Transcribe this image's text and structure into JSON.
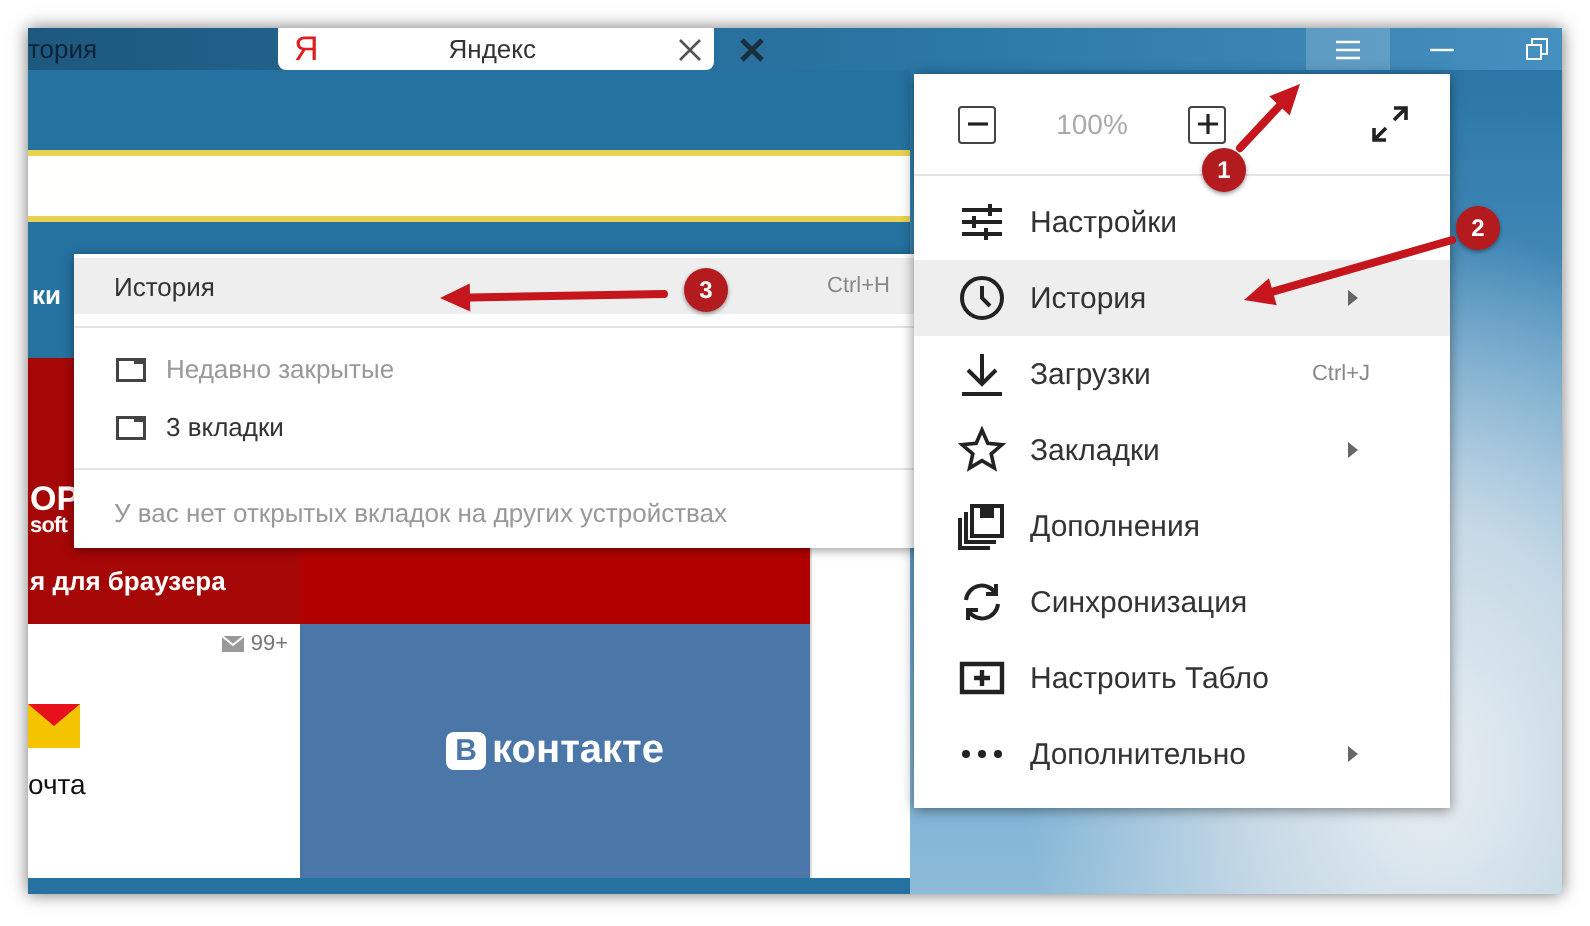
{
  "tab_bar": {
    "tabs": [
      {
        "label": "тория",
        "selected": false
      },
      {
        "label": "Яндекс",
        "selected": true,
        "logo": "Я"
      }
    ]
  },
  "tiles": {
    "cut_label": "ки",
    "promo": {
      "lines": [
        "OP",
        "soft"
      ],
      "caption": "я для браузера"
    },
    "mail": {
      "count": "99+",
      "caption": "очта"
    },
    "vk": {
      "logo": "В",
      "name": "контакте"
    }
  },
  "history_submenu": {
    "items": [
      {
        "kind": "header",
        "label": "История",
        "shortcut": "Ctrl+H",
        "selected": true
      },
      {
        "kind": "tab",
        "label": "Недавно закрытые",
        "disabled": true
      },
      {
        "kind": "tab",
        "label": "3 вкладки",
        "disabled": false
      },
      {
        "kind": "note",
        "label": "У вас нет открытых вкладок на других устройствах"
      }
    ]
  },
  "main_menu": {
    "zoom_level": "100%",
    "items": [
      {
        "label": "Настройки",
        "selected": false,
        "submenu": false
      },
      {
        "label": "История",
        "selected": true,
        "submenu": true
      },
      {
        "label": "Загрузки",
        "shortcut": "Ctrl+J",
        "selected": false,
        "submenu": false
      },
      {
        "label": "Закладки",
        "selected": false,
        "submenu": true
      },
      {
        "label": "Дополнения",
        "selected": false,
        "submenu": false
      },
      {
        "label": "Синхронизация",
        "selected": false,
        "submenu": false
      },
      {
        "label": "Настроить Табло",
        "selected": false,
        "submenu": false
      },
      {
        "label": "Дополнительно",
        "selected": false,
        "submenu": true
      }
    ]
  },
  "annotations": [
    {
      "number": "1"
    },
    {
      "number": "2"
    },
    {
      "number": "3"
    }
  ]
}
